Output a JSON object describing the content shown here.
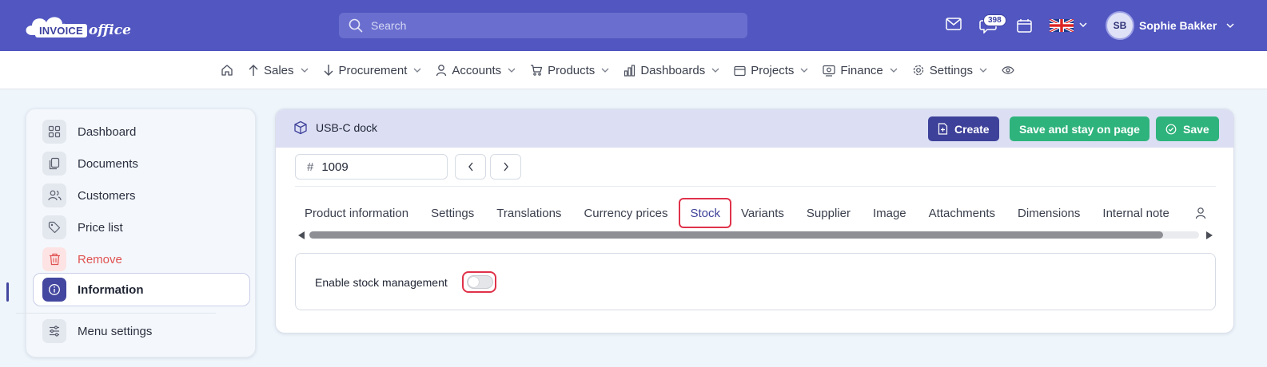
{
  "app": {
    "logo_word": "INVOICE",
    "logo_word2": "office",
    "search_placeholder": "Search",
    "notification_count": "398",
    "user_initials": "SB",
    "user_name": "Sophie Bakker"
  },
  "nav": {
    "items": [
      {
        "label": "Sales",
        "icon": "arrow-up-icon"
      },
      {
        "label": "Procurement",
        "icon": "arrow-down-icon"
      },
      {
        "label": "Accounts",
        "icon": "user-icon"
      },
      {
        "label": "Products",
        "icon": "cart-icon"
      },
      {
        "label": "Dashboards",
        "icon": "bar-chart-icon"
      },
      {
        "label": "Projects",
        "icon": "calendar-icon"
      },
      {
        "label": "Finance",
        "icon": "finance-icon"
      },
      {
        "label": "Settings",
        "icon": "gear-icon"
      }
    ]
  },
  "sidebar": {
    "items": [
      {
        "label": "Dashboard",
        "icon": "grid-icon"
      },
      {
        "label": "Documents",
        "icon": "documents-icon"
      },
      {
        "label": "Customers",
        "icon": "users-icon"
      },
      {
        "label": "Price list",
        "icon": "tag-icon"
      },
      {
        "label": "Remove",
        "icon": "trash-icon"
      },
      {
        "label": "Information",
        "icon": "info-icon"
      },
      {
        "label": "Menu settings",
        "icon": "sliders-icon"
      }
    ]
  },
  "product": {
    "title": "USB-C dock",
    "id_value": "1009"
  },
  "toolbar": {
    "create_label": "Create",
    "stay_label": "Save and stay on page",
    "save_label": "Save"
  },
  "tabs": [
    "Product information",
    "Settings",
    "Translations",
    "Currency prices",
    "Stock",
    "Variants",
    "Supplier",
    "Image",
    "Attachments",
    "Dimensions",
    "Internal note"
  ],
  "active_tab": "Stock",
  "stock": {
    "label": "Enable stock management",
    "enabled": false
  },
  "colors": {
    "primary": "#5156c0",
    "button_dark": "#3e4199",
    "button_green": "#2fb37c",
    "highlight_red": "#e0324a",
    "danger": "#e05252"
  }
}
